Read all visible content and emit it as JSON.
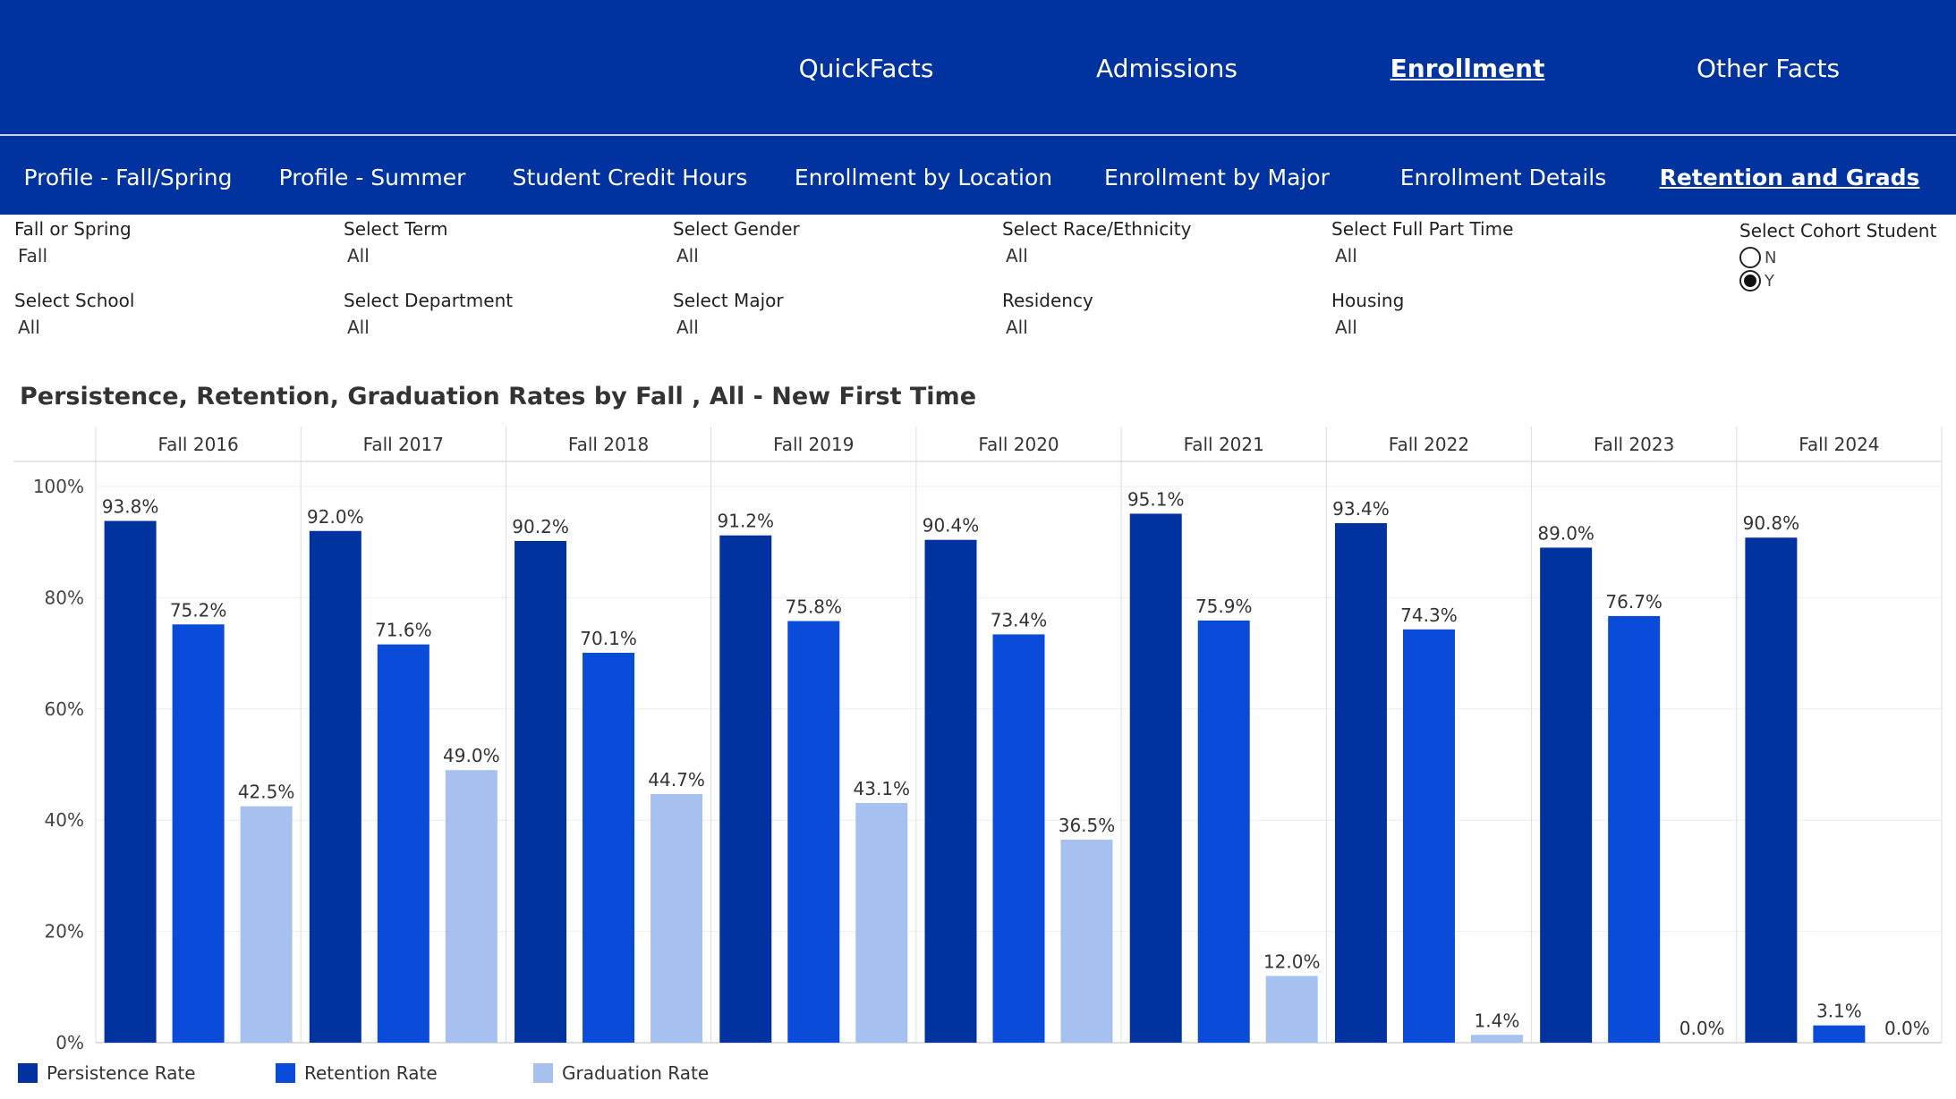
{
  "top_nav": {
    "items": [
      {
        "label": "QuickFacts",
        "active": false
      },
      {
        "label": "Admissions",
        "active": false
      },
      {
        "label": "Enrollment",
        "active": true
      },
      {
        "label": "Other Facts",
        "active": false
      }
    ]
  },
  "sub_nav": {
    "items": [
      {
        "label": "Profile - Fall/Spring",
        "active": false
      },
      {
        "label": "Profile - Summer",
        "active": false
      },
      {
        "label": "Student Credit Hours",
        "active": false
      },
      {
        "label": "Enrollment by Location",
        "active": false
      },
      {
        "label": "Enrollment by Major",
        "active": false
      },
      {
        "label": "Enrollment Details",
        "active": false
      },
      {
        "label": "Retention and Grads",
        "active": true
      }
    ]
  },
  "filters": [
    {
      "label": "Fall or Spring",
      "value": "Fall"
    },
    {
      "label": "Select Term",
      "value": "All"
    },
    {
      "label": "Select Gender",
      "value": "All"
    },
    {
      "label": "Select Race/Ethnicity",
      "value": "All"
    },
    {
      "label": "Select Full Part Time",
      "value": "All"
    },
    {
      "label": "Select School",
      "value": "All"
    },
    {
      "label": "Select Department",
      "value": "All"
    },
    {
      "label": "Select Major",
      "value": "All"
    },
    {
      "label": "Residency",
      "value": "All"
    },
    {
      "label": "Housing",
      "value": "All"
    }
  ],
  "cohort_filter": {
    "label": "Select Cohort Student",
    "options": [
      {
        "label": "N",
        "selected": false
      },
      {
        "label": "Y",
        "selected": true
      }
    ]
  },
  "colors": {
    "nav_background": "#0033a0",
    "persistence": "#0033a0",
    "retention": "#0a4bd9",
    "graduation": "#a6c0f0"
  },
  "chart_data": {
    "type": "bar",
    "title": "Persistence, Retention, Graduation Rates by Fall , All - New First Time",
    "categories": [
      "Fall 2016",
      "Fall 2017",
      "Fall 2018",
      "Fall 2019",
      "Fall 2020",
      "Fall 2021",
      "Fall 2022",
      "Fall 2023",
      "Fall 2024"
    ],
    "series": [
      {
        "name": "Persistence Rate",
        "values": [
          93.8,
          92.0,
          90.2,
          91.2,
          90.4,
          95.1,
          93.4,
          89.0,
          90.8
        ],
        "labels": [
          "93.8%",
          "92.0%",
          "90.2%",
          "91.2%",
          "90.4%",
          "95.1%",
          "93.4%",
          "89.0%",
          "90.8%"
        ]
      },
      {
        "name": "Retention Rate",
        "values": [
          75.2,
          71.6,
          70.1,
          75.8,
          73.4,
          75.9,
          74.3,
          76.7,
          3.1
        ],
        "labels": [
          "75.2%",
          "71.6%",
          "70.1%",
          "75.8%",
          "73.4%",
          "75.9%",
          "74.3%",
          "76.7%",
          "3.1%"
        ]
      },
      {
        "name": "Graduation Rate",
        "values": [
          42.5,
          49.0,
          44.7,
          43.1,
          36.5,
          12.0,
          1.4,
          0.0,
          0.0
        ],
        "labels": [
          "42.5%",
          "49.0%",
          "44.7%",
          "43.1%",
          "36.5%",
          "12.0%",
          "1.4%",
          "0.0%",
          "0.0%"
        ]
      }
    ],
    "ylim": [
      0,
      100
    ],
    "y_ticks": [
      "0%",
      "20%",
      "40%",
      "60%",
      "80%",
      "100%"
    ],
    "grid": true,
    "legend_position": "bottom-left"
  }
}
